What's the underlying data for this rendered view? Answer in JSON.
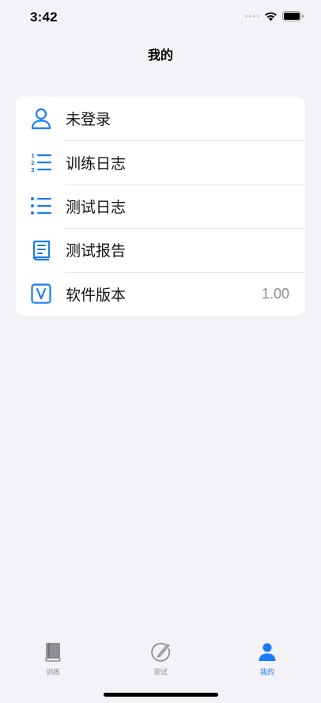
{
  "status_bar": {
    "time": "3:42"
  },
  "nav": {
    "title": "我的"
  },
  "menu": {
    "items": [
      {
        "label": "未登录",
        "icon": "person-icon"
      },
      {
        "label": "训练日志",
        "icon": "numbered-list-icon"
      },
      {
        "label": "测试日志",
        "icon": "bulleted-list-icon"
      },
      {
        "label": "测试报告",
        "icon": "report-book-icon"
      },
      {
        "label": "软件版本",
        "icon": "version-v-icon",
        "value": "1.00"
      }
    ]
  },
  "tabs": [
    {
      "label": "训练",
      "icon": "book-icon",
      "active": false
    },
    {
      "label": "测试",
      "icon": "pencil-circle-icon",
      "active": false
    },
    {
      "label": "我的",
      "icon": "person-fill-icon",
      "active": true
    }
  ],
  "colors": {
    "accent": "#1a7cf5",
    "background": "#f2f2f7",
    "inactive": "#8e8e93"
  }
}
